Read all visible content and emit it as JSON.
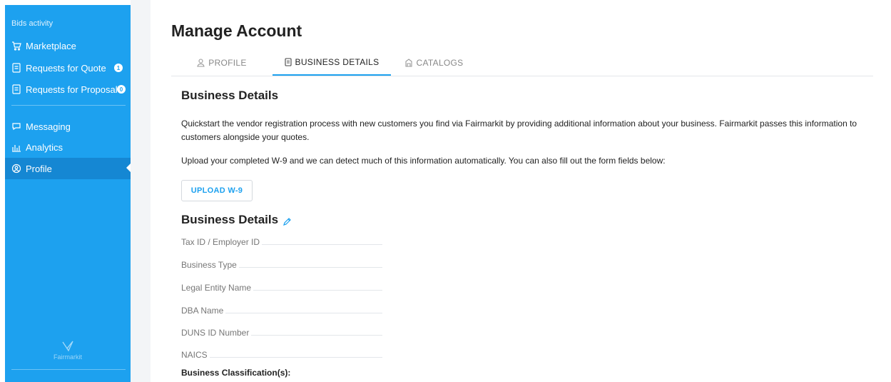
{
  "sidebar": {
    "section_label": "Bids activity",
    "items": [
      {
        "label": "Marketplace",
        "icon": "cart-icon"
      },
      {
        "label": "Requests for Quote",
        "icon": "document-icon",
        "badge": "1"
      },
      {
        "label": "Requests for Proposal",
        "icon": "document-icon",
        "badge": "0"
      },
      {
        "label": "Messaging",
        "icon": "chat-icon"
      },
      {
        "label": "Analytics",
        "icon": "analytics-icon"
      },
      {
        "label": "Profile",
        "icon": "user-circle-icon",
        "active": true
      }
    ],
    "logo_text": "Fairmarkit"
  },
  "page": {
    "title": "Manage Account",
    "tabs": [
      {
        "label": "PROFILE",
        "icon": "user-icon"
      },
      {
        "label": "BUSINESS DETAILS",
        "icon": "document-icon",
        "active": true
      },
      {
        "label": "CATALOGS",
        "icon": "catalog-icon"
      }
    ]
  },
  "business": {
    "heading": "Business Details",
    "intro": "Quickstart the vendor registration process with new customers you find via Fairmarkit by providing additional information about your business. Fairmarkit passes this information to customers alongside your quotes.",
    "upload_text": "Upload your completed W-9 and we can detect much of this information automatically. You can also fill out the form fields below:",
    "upload_button": "UPLOAD W-9",
    "details_heading": "Business Details",
    "fields": [
      {
        "label": "Tax ID / Employer ID",
        "value": ""
      },
      {
        "label": "Business Type",
        "value": ""
      },
      {
        "label": "Legal Entity Name",
        "value": ""
      },
      {
        "label": "DBA Name",
        "value": ""
      },
      {
        "label": "DUNS ID Number",
        "value": ""
      },
      {
        "label": "NAICS",
        "value": ""
      }
    ],
    "classification_label": "Business Classification(s):"
  },
  "colors": {
    "accent": "#1da1ef",
    "sidebar_active": "#1587d3"
  }
}
